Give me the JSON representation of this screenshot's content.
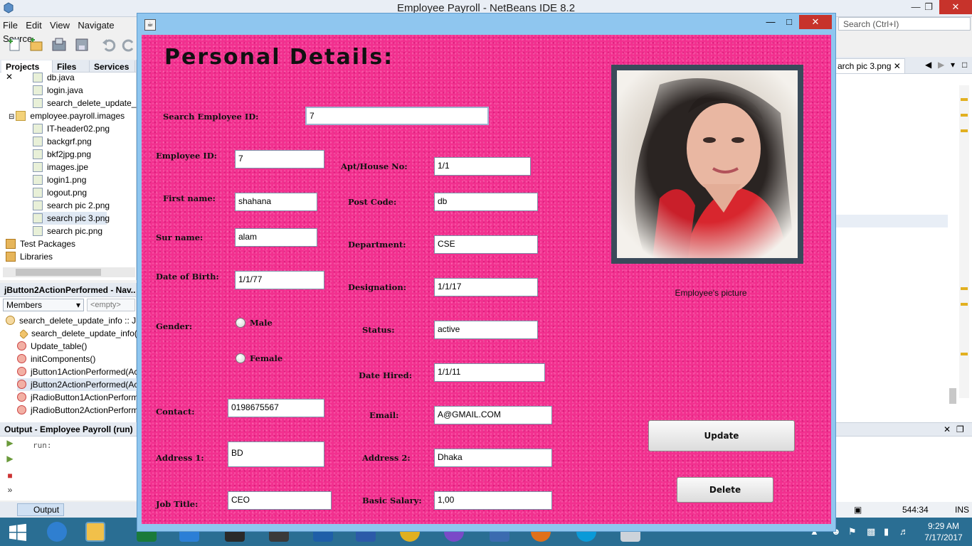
{
  "ide": {
    "title": "Employee Payroll - NetBeans IDE 8.2",
    "menu": [
      "File",
      "Edit",
      "View",
      "Navigate",
      "Source"
    ],
    "search_placeholder": "Search (Ctrl+I)",
    "panel_tabs": [
      "Projects",
      "Files",
      "Services"
    ],
    "tree": [
      "db.java",
      "login.java",
      "search_delete_update_in",
      "employee.payroll.images",
      "IT-header02.png",
      "backgrf.png",
      "bkf2jpg.png",
      "images.jpe",
      "login1.png",
      "logout.png",
      "search pic 2.png",
      "search pic 3.png",
      "search pic.png",
      "Test Packages",
      "Libraries"
    ],
    "navigator_title": "jButton2ActionPerformed - Nav...",
    "navigator_filter": "Members",
    "navigator_empty": "<empty>",
    "navigator_items": [
      "search_delete_update_info :: JFra",
      "search_delete_update_info()",
      "Update_table()",
      "initComponents()",
      "jButton1ActionPerformed(Acti",
      "jButton2ActionPerformed(Acti",
      "jRadioButton1ActionPerforme",
      "jRadioButton2ActionPerforme"
    ],
    "output_title": "Output - Employee Payroll (run)",
    "output_text": "run:",
    "output_tab": "Output",
    "editor_tab": "arch pic 3.png",
    "cursor_pos": "544:34",
    "insert_mode": "INS",
    "clock_time": "9:29 AM",
    "clock_date": "7/17/2017"
  },
  "form": {
    "title": "Personal Details:",
    "search_label": "Search Employee ID:",
    "search_value": "7",
    "labels": {
      "employee_id": "Employee ID:",
      "first_name": "First name:",
      "sur_name": "Sur name:",
      "dob": "Date of Birth:",
      "gender": "Gender:",
      "male": "Male",
      "female": "Female",
      "contact": "Contact:",
      "address1": "Address 1:",
      "job_title": "Job Title:",
      "apt_house": "Apt/House No:",
      "post_code": "Post Code:",
      "department": "Department:",
      "designation": "Designation:",
      "status": "Status:",
      "date_hired": "Date Hired:",
      "email": "Email:",
      "address2": "Address 2:",
      "basic_salary": "Basic Salary:"
    },
    "values": {
      "employee_id": "7",
      "first_name": "shahana",
      "sur_name": "alam",
      "dob": "1/1/77",
      "contact": "0198675567",
      "address1": "BD",
      "job_title": "CEO",
      "apt_house": "1/1",
      "post_code": "db",
      "department": "CSE",
      "designation": "1/1/17",
      "status": "active",
      "date_hired": "1/1/11",
      "email": "A@GMAIL.COM",
      "address2": "Dhaka",
      "basic_salary": "1,00"
    },
    "photo_caption": "Employee's picture",
    "update_label": "Update",
    "delete_label": "Delete"
  }
}
